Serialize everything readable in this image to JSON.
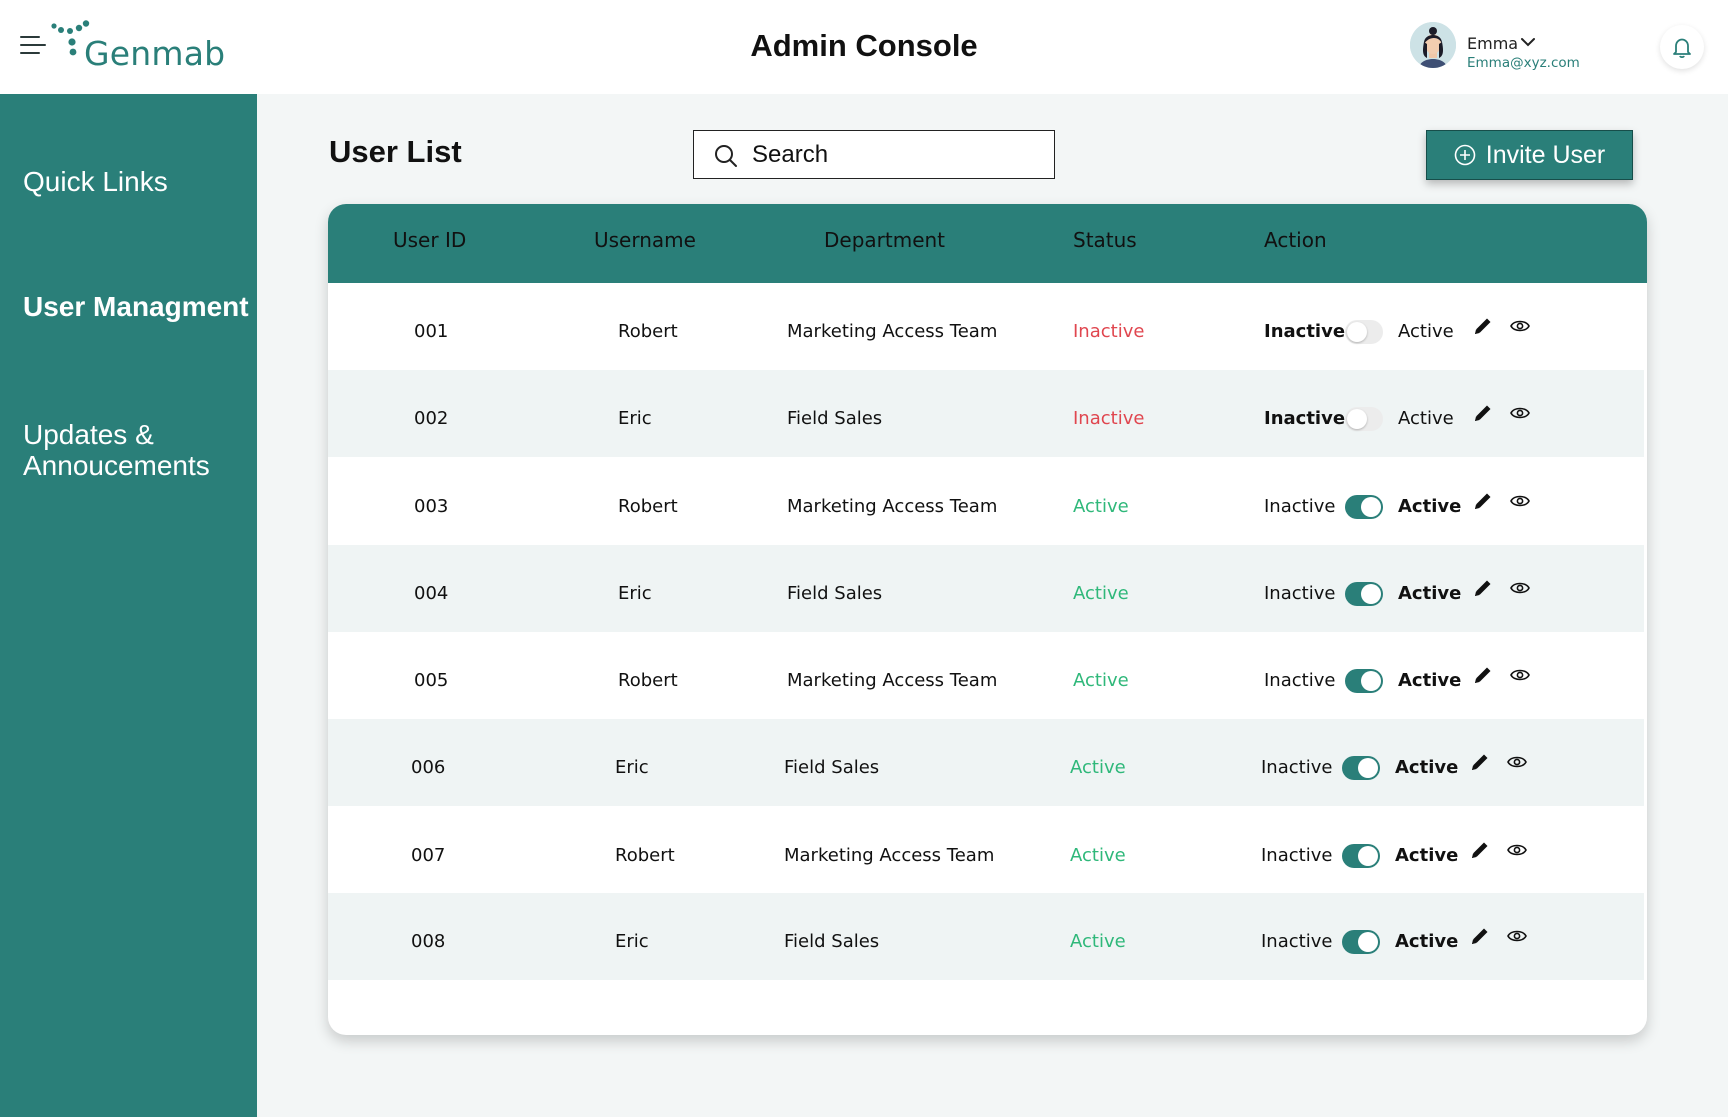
{
  "header": {
    "logo_text": "Genmab",
    "title": "Admin Console",
    "user": {
      "name": "Emma",
      "email": "Emma@xyz.com"
    }
  },
  "sidebar": {
    "items": [
      {
        "label": "Quick Links",
        "active": false
      },
      {
        "label": "User Managment",
        "active": true
      },
      {
        "label": "Updates & Annoucements",
        "active": false
      }
    ]
  },
  "main": {
    "heading": "User List",
    "search_placeholder": "Search",
    "invite_label": "Invite User",
    "columns": [
      "User ID",
      "Username",
      "Department",
      "Status",
      "Action"
    ],
    "toggle_labels": {
      "inactive": "Inactive",
      "active": "Active"
    },
    "rows": [
      {
        "id": "001",
        "username": "Robert",
        "department": "Marketing Access Team",
        "status": "Inactive"
      },
      {
        "id": "002",
        "username": "Eric",
        "department": "Field Sales",
        "status": "Inactive"
      },
      {
        "id": "003",
        "username": "Robert",
        "department": "Marketing Access Team",
        "status": "Active"
      },
      {
        "id": "004",
        "username": "Eric",
        "department": "Field Sales",
        "status": "Active"
      },
      {
        "id": "005",
        "username": "Robert",
        "department": "Marketing Access Team",
        "status": "Active"
      },
      {
        "id": "006",
        "username": "Eric",
        "department": "Field Sales",
        "status": "Active"
      },
      {
        "id": "007",
        "username": "Robert",
        "department": "Marketing Access Team",
        "status": "Active"
      },
      {
        "id": "008",
        "username": "Eric",
        "department": "Field Sales",
        "status": "Active"
      }
    ]
  },
  "colors": {
    "brand": "#2a7f79",
    "inactive": "#e0464f",
    "active": "#2fb87a"
  }
}
